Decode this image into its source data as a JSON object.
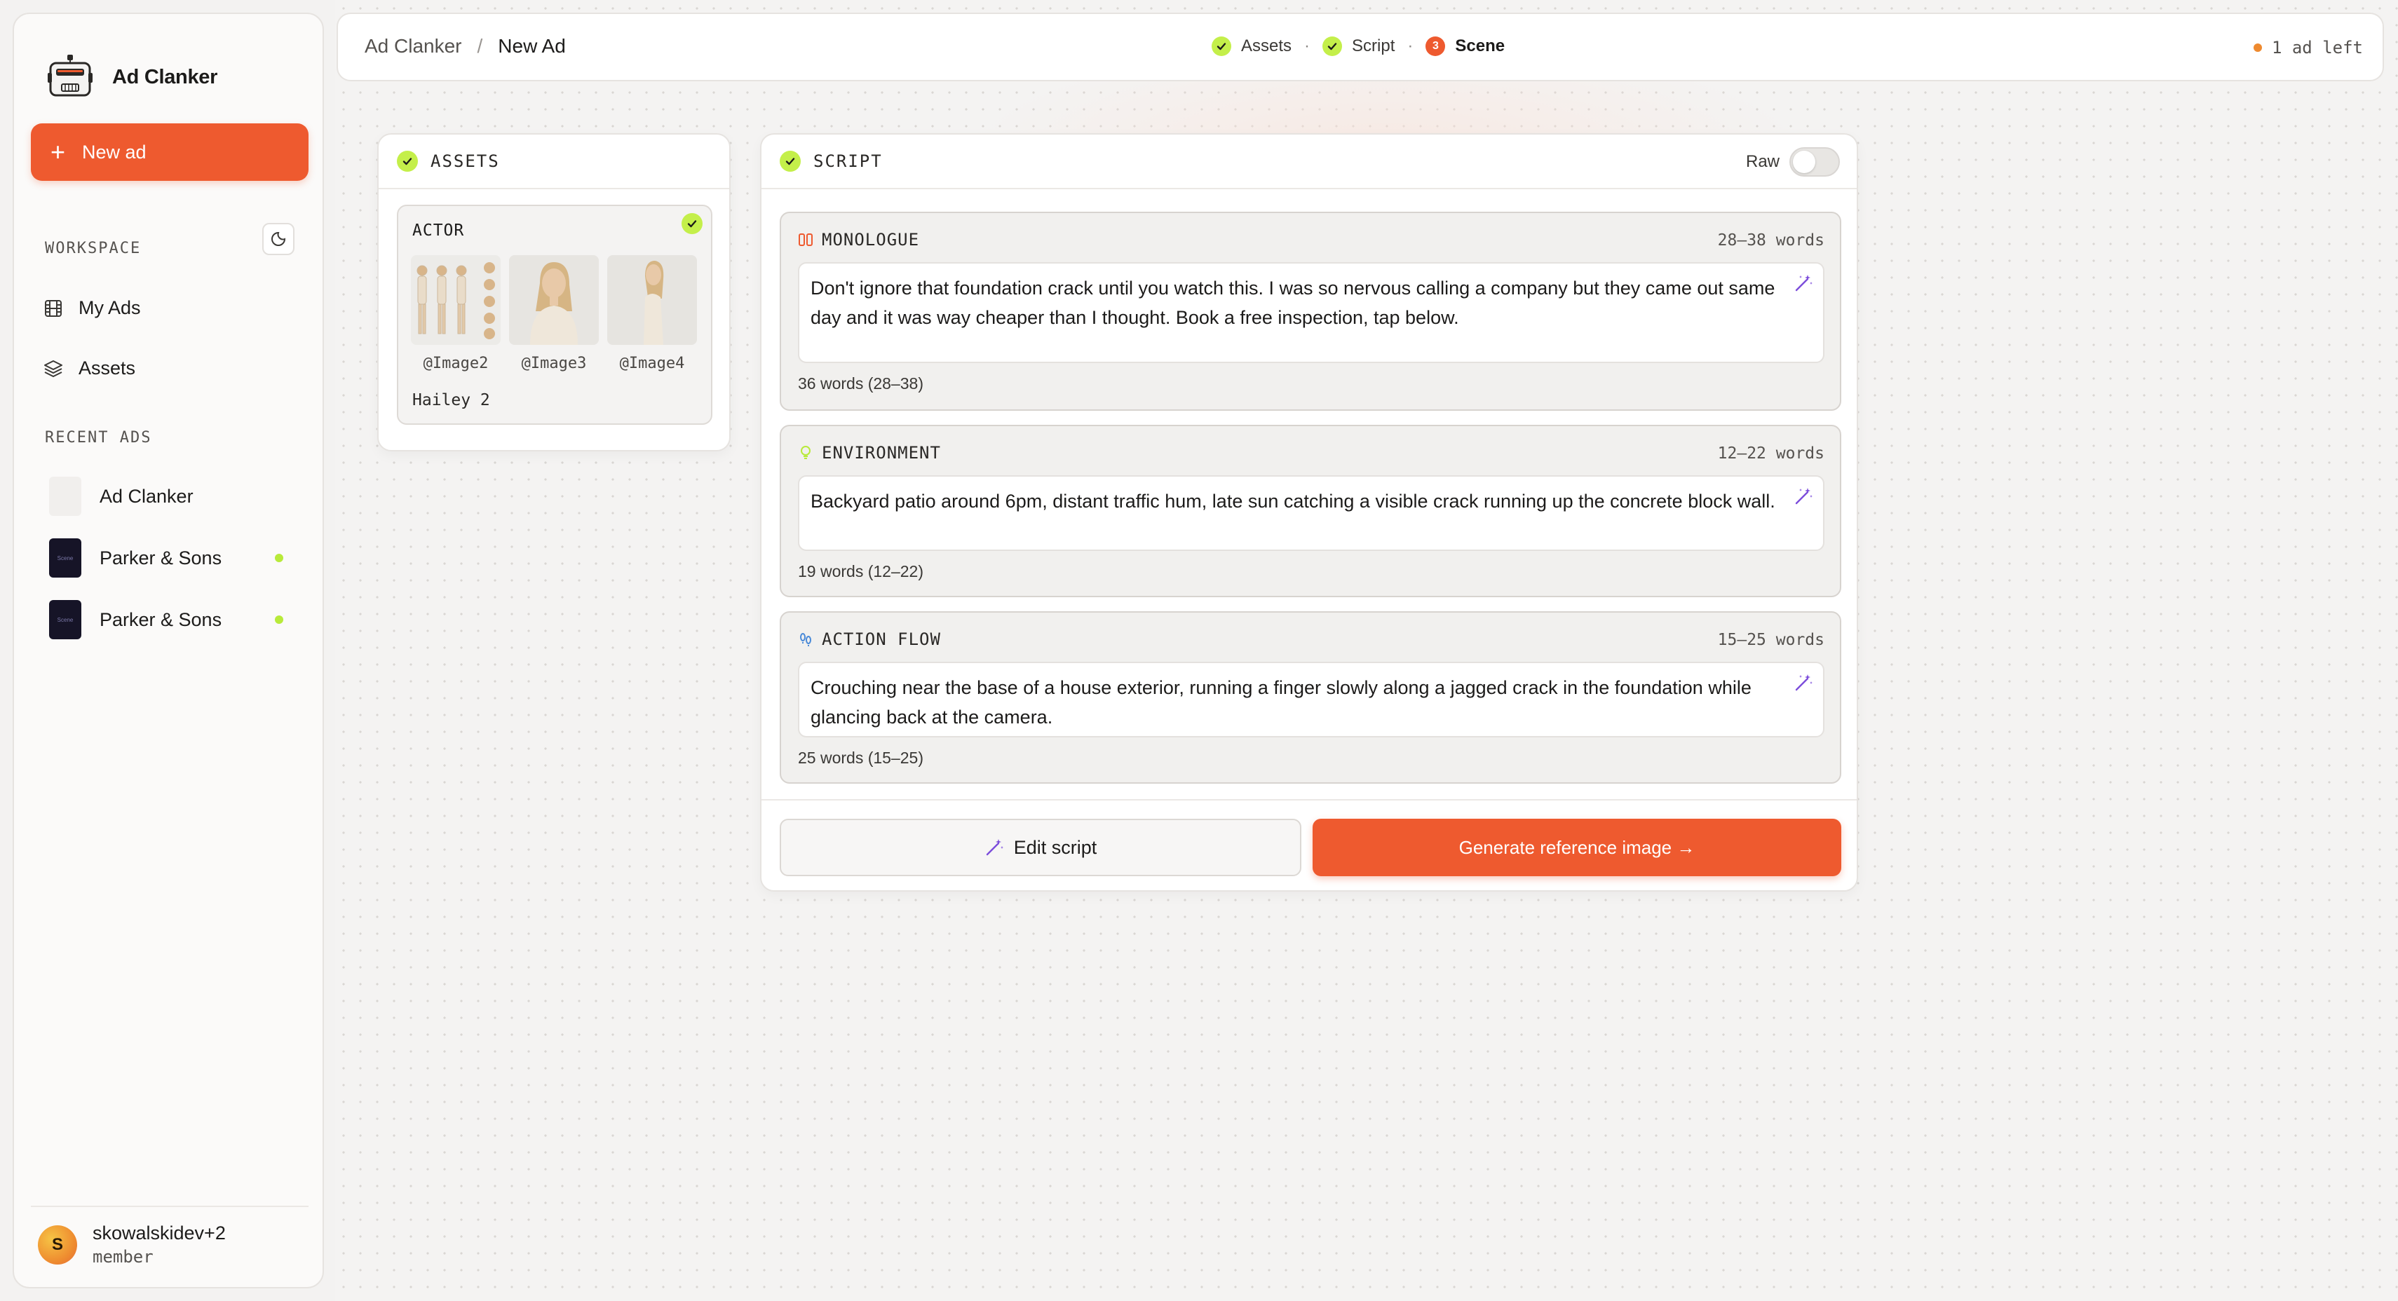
{
  "app": {
    "name": "Ad Clanker"
  },
  "sidebar": {
    "new_ad_label": "New ad",
    "workspace_label": "WORKSPACE",
    "nav": [
      {
        "label": "My Ads",
        "icon": "film-icon"
      },
      {
        "label": "Assets",
        "icon": "layers-icon"
      }
    ],
    "recent_label": "RECENT ADS",
    "recent": [
      {
        "label": "Ad Clanker",
        "status": ""
      },
      {
        "label": "Parker & Sons",
        "thumb_text": "Scene",
        "status": "active"
      },
      {
        "label": "Parker & Sons",
        "thumb_text": "Scene",
        "status": "active"
      }
    ],
    "user": {
      "initial": "S",
      "name": "skowalskidev+2",
      "role": "member"
    }
  },
  "topbar": {
    "breadcrumb": [
      "Ad Clanker",
      "/",
      "New Ad"
    ],
    "steps": [
      {
        "label": "Assets",
        "state": "done"
      },
      {
        "label": "Script",
        "state": "done"
      },
      {
        "label": "Scene",
        "state": "current",
        "number": "3"
      }
    ],
    "step_separator": "·",
    "ads_left": "1 ad left"
  },
  "assets_node": {
    "title": "ASSETS",
    "actor": {
      "label": "ACTOR",
      "images": [
        "@Image2",
        "@Image3",
        "@Image4"
      ],
      "name": "Hailey 2"
    }
  },
  "script_node": {
    "title": "SCRIPT",
    "raw_label": "Raw",
    "raw_enabled": false,
    "sections": [
      {
        "title": "MONOLOGUE",
        "range": "28–38 words",
        "text": "Don't ignore that foundation crack until you watch this. I was so nervous calling a company but they came out same day and it was way cheaper than I thought. Book a free inspection, tap below.",
        "count": "36 words (28–38)"
      },
      {
        "title": "ENVIRONMENT",
        "range": "12–22 words",
        "text": "Backyard patio around 6pm, distant traffic hum, late sun catching a visible crack running up the concrete block wall.",
        "count": "19 words (12–22)"
      },
      {
        "title": "ACTION FLOW",
        "range": "15–25 words",
        "text": "Crouching near the base of a house exterior, running a finger slowly along a jagged crack in the foundation while glancing back at the camera.",
        "count": "25 words (15–25)"
      }
    ],
    "edit_label": "Edit script",
    "generate_label": "Generate reference image →"
  },
  "colors": {
    "accent": "#ee5a2f",
    "success": "#c4ef4a",
    "status_dot": "#b8ea3a"
  }
}
